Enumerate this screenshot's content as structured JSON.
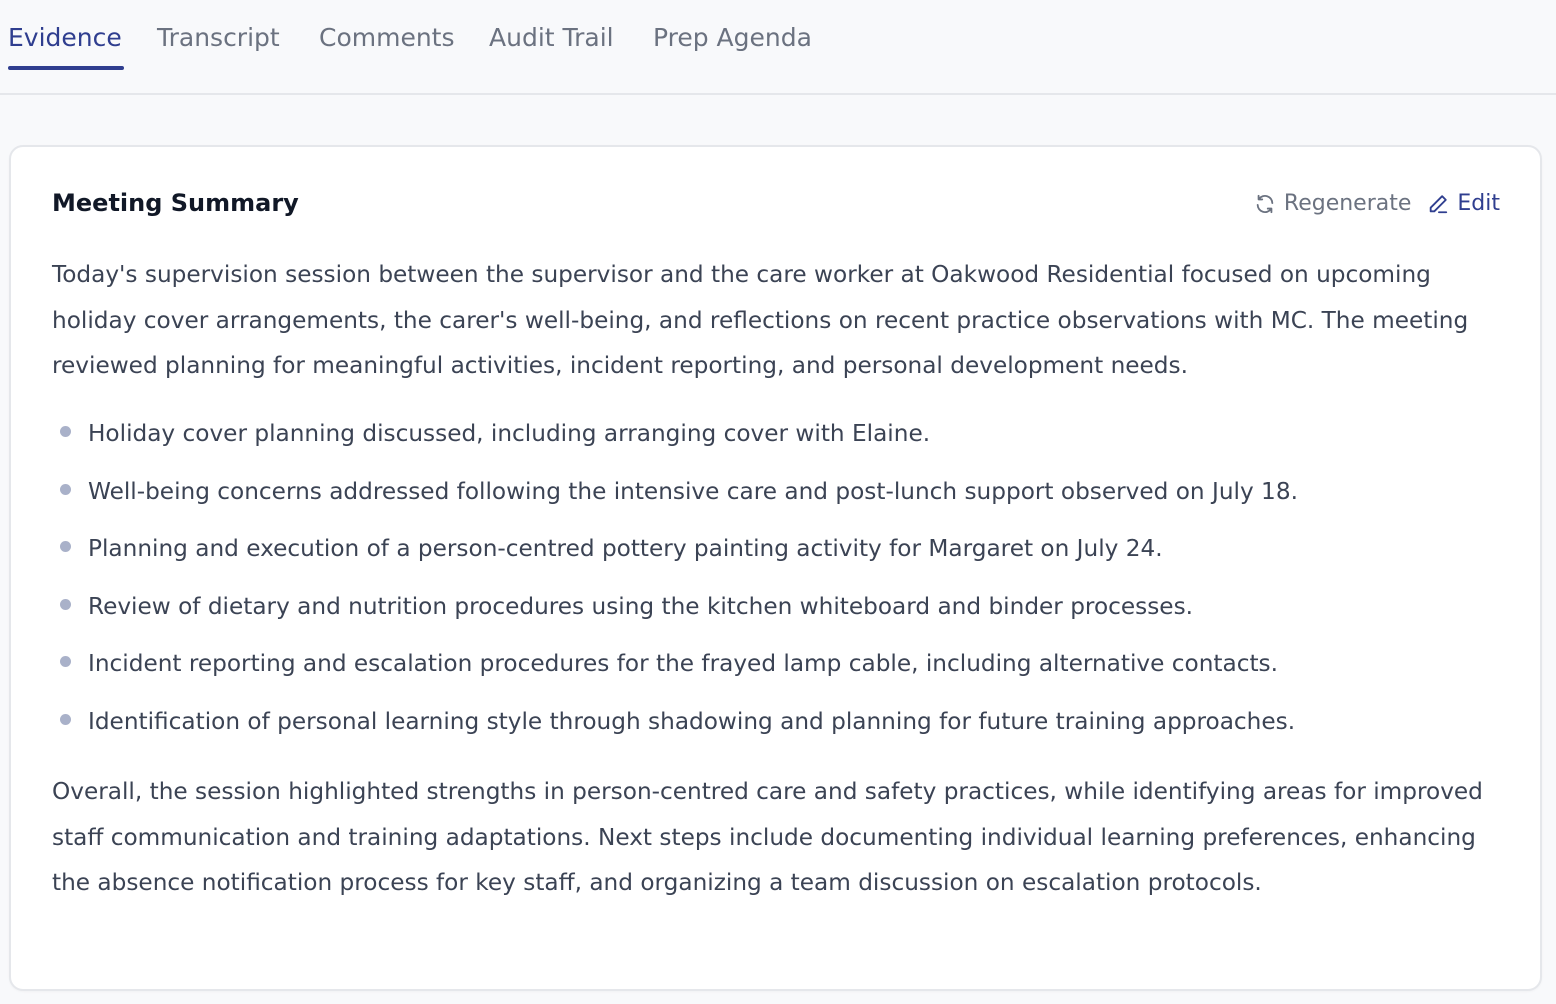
{
  "tabs": [
    {
      "label": "Evidence",
      "active": true
    },
    {
      "label": "Transcript",
      "active": false
    },
    {
      "label": "Comments",
      "active": false
    },
    {
      "label": "Audit Trail",
      "active": false
    },
    {
      "label": "Prep Agenda",
      "active": false
    }
  ],
  "summary": {
    "title": "Meeting Summary",
    "regenerate_label": "Regenerate",
    "edit_label": "Edit",
    "intro": "Today's supervision session between the supervisor and the care worker at Oakwood Residential focused on upcoming holiday cover arrangements, the carer's well-being, and reflections on recent practice observations with MC. The meeting reviewed planning for meaningful activities, incident reporting, and personal development needs.",
    "points": [
      "Holiday cover planning discussed, including arranging cover with Elaine.",
      "Well-being concerns addressed following the intensive care and post-lunch support observed on July 18.",
      "Planning and execution of a person-centred pottery painting activity for Margaret on July 24.",
      "Review of dietary and nutrition procedures using the kitchen whiteboard and binder processes.",
      "Incident reporting and escalation procedures for the frayed lamp cable, including alternative contacts.",
      "Identification of personal learning style through shadowing and planning for future training approaches."
    ],
    "conclusion": "Overall, the session highlighted strengths in person-centred care and safety practices, while identifying areas for improved staff communication and training adaptations. Next steps include documenting individual learning preferences, enhancing the absence notification process for key staff, and organizing a team discussion on escalation protocols."
  },
  "colors": {
    "accent": "#2f3e8f",
    "muted": "#6b7280",
    "body_text": "#3b4354",
    "bullet": "#a9b1c9"
  },
  "icons": {
    "regenerate": "refresh-icon",
    "edit": "pencil-icon"
  }
}
